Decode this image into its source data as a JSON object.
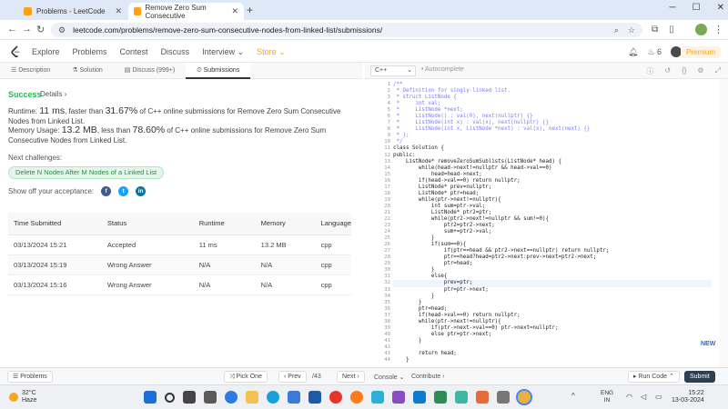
{
  "browser": {
    "tabs": [
      {
        "title": "Problems - LeetCode",
        "active": false
      },
      {
        "title": "Remove Zero Sum Consecutive",
        "active": true
      }
    ],
    "url": "leetcode.com/problems/remove-zero-sum-consecutive-nodes-from-linked-list/submissions/"
  },
  "nav": {
    "links": [
      "Explore",
      "Problems",
      "Contest",
      "Discuss",
      "Interview",
      "Store"
    ],
    "fire_count": "6",
    "premium_label": "Premium"
  },
  "left_tabs": [
    "Description",
    "Solution",
    "Discuss (999+)",
    "Submissions"
  ],
  "result": {
    "status": "Success",
    "details_label": "Details",
    "runtime_label": "Runtime:",
    "runtime_value": "11 ms",
    "runtime_mid": ", faster than",
    "runtime_pct": "31.67%",
    "runtime_tail": "of C++ online submissions for Remove Zero Sum Consecutive Nodes from Linked List.",
    "memory_label": "Memory Usage:",
    "memory_value": "13.2 MB",
    "memory_mid": ", less than",
    "memory_pct": "78.60%",
    "memory_tail": "of C++ online submissions for Remove Zero Sum Consecutive Nodes from Linked List.",
    "next_label": "Next challenges:",
    "next_challenge": "Delete N Nodes After M Nodes of a Linked List",
    "share_label": "Show off your acceptance:"
  },
  "submissions": {
    "headers": [
      "Time Submitted",
      "Status",
      "Runtime",
      "Memory",
      "Language"
    ],
    "rows": [
      {
        "time": "03/13/2024 15:21",
        "status": "Accepted",
        "runtime": "11 ms",
        "memory": "13.2 MB",
        "language": "cpp"
      },
      {
        "time": "03/13/2024 15:19",
        "status": "Wrong Answer",
        "runtime": "N/A",
        "memory": "N/A",
        "language": "cpp"
      },
      {
        "time": "03/13/2024 15:16",
        "status": "Wrong Answer",
        "runtime": "N/A",
        "memory": "N/A",
        "language": "cpp"
      }
    ]
  },
  "editor": {
    "language": "C++",
    "autocomplete_label": "Autocomplete",
    "code_lines": [
      "/**",
      " * Definition for singly-linked list.",
      " * struct ListNode {",
      " *     int val;",
      " *     ListNode *next;",
      " *     ListNode() : val(0), next(nullptr) {}",
      " *     ListNode(int x) : val(x), next(nullptr) {}",
      " *     ListNode(int x, ListNode *next) : val(x), next(next) {}",
      " * };",
      " */",
      "class Solution {",
      "public:",
      "    ListNode* removeZeroSumSublists(ListNode* head) {",
      "        while(head->next!=nullptr && head->val==0)",
      "            head=head->next;",
      "        if(head->val==0) return nullptr;",
      "        ListNode* prev=nullptr;",
      "        ListNode* ptr=head;",
      "        while(ptr->next!=nullptr){",
      "            int sum=ptr->val;",
      "            ListNode* ptr2=ptr;",
      "            while(ptr2->next!=nullptr && sum!=0){",
      "                ptr2=ptr2->next;",
      "                sum+=ptr2->val;",
      "            }",
      "            if(sum==0){",
      "                if(ptr==head && ptr2->next==nullptr) return nullptr;",
      "                ptr==head?head=ptr2->next:prev->next=ptr2->next;",
      "                ptr=head;",
      "            }",
      "            else{",
      "                prev=ptr;",
      "                ptr=ptr->next;",
      "            }",
      "        }",
      "        ptr=head;",
      "        if(head->val==0) return nullptr;",
      "        while(ptr->next!=nullptr){",
      "            if(ptr->next->val==0) ptr->next=nullptr;",
      "            else ptr=ptr->next;",
      "        }",
      "",
      "        return head;",
      "    }"
    ],
    "new_badge": "NEW"
  },
  "bottom": {
    "problems_label": "Problems",
    "pick_one_label": "Pick One",
    "prev_label": "Prev",
    "page_indicator": "/43",
    "next_label": "Next",
    "console_label": "Console",
    "contribute_label": "Contribute",
    "run_label": "Run Code",
    "submit_label": "Submit"
  },
  "taskbar": {
    "temperature": "32°C",
    "weather": "Haze",
    "lang_line1": "ENG",
    "lang_line2": "IN",
    "time": "15:22",
    "date": "13-03-2024"
  },
  "colors": {
    "accent": "#ffa116",
    "success": "#2db55d",
    "error": "#ef4743",
    "submit": "#2c3e50"
  }
}
